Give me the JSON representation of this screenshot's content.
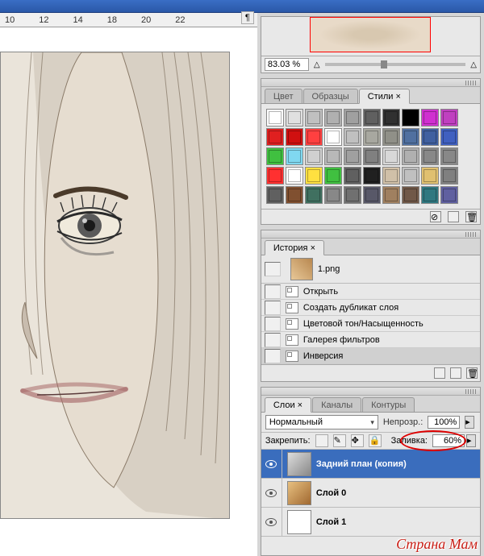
{
  "top": {
    "pilcrow": "¶"
  },
  "ruler": {
    "marks": [
      "10",
      "12",
      "14",
      "18",
      "20",
      "22"
    ]
  },
  "navigator": {
    "zoom_value": "83.03 %"
  },
  "styles_panel": {
    "tabs": [
      "Цвет",
      "Образцы",
      "Стили"
    ],
    "swatches": [
      "#ffffff",
      "#e0e0e0",
      "#c0c0c0",
      "#b0b0b0",
      "#a0a0a0",
      "#606060",
      "#303030",
      "#000000",
      "#d030d0",
      "#c040c0",
      "#e02020",
      "#d01010",
      "#ff4040",
      "#ffffff",
      "#c0c0c0",
      "#a8a8a0",
      "#909088",
      "#5070a0",
      "#4060a0",
      "#4060c0",
      "#40c040",
      "#80d8f0",
      "#d0d0d0",
      "#b8b8b8",
      "#a0a0a0",
      "#808080",
      "#d8d8d8",
      "#b0b0b0",
      "#888888",
      "#888888",
      "#ff3030",
      "#ffffff",
      "#ffe040",
      "#40c040",
      "#606060",
      "#202020",
      "#d0c0a8",
      "#c0c0c0",
      "#e0c070",
      "#808080",
      "#606060",
      "#805030",
      "#407060",
      "#888888",
      "#707070",
      "#585868",
      "#a08060",
      "#705848",
      "#307880",
      "#6060a0"
    ]
  },
  "history_panel": {
    "tab": "История",
    "doc_name": "1.png",
    "items": [
      "Открыть",
      "Создать дубликат слоя",
      "Цветовой тон/Насыщенность",
      "Галерея фильтров",
      "Инверсия"
    ]
  },
  "layers_panel": {
    "tabs": [
      "Слои",
      "Каналы",
      "Контуры"
    ],
    "blend_mode": "Нормальный",
    "opacity_label": "Непрозр.:",
    "opacity_value": "100%",
    "lock_label": "Закрепить:",
    "fill_label": "Заливка:",
    "fill_value": "60%",
    "layers": [
      {
        "name": "Задний план (копия)",
        "active": true,
        "thumb": "t0"
      },
      {
        "name": "Слой 0",
        "active": false,
        "thumb": "t1"
      },
      {
        "name": "Слой 1",
        "active": false,
        "thumb": ""
      }
    ]
  },
  "watermark": "Страна Мам"
}
